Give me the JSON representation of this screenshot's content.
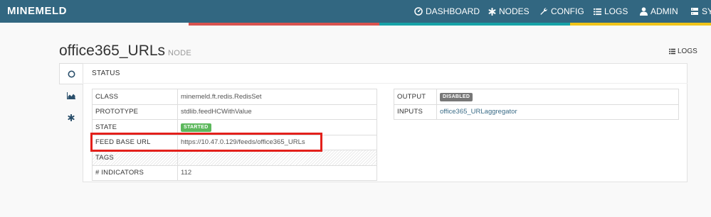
{
  "navbar": {
    "brand": "MINEMELD",
    "items": [
      {
        "label": "DASHBOARD",
        "icon": "dashboard-icon"
      },
      {
        "label": "NODES",
        "icon": "asterisk-icon"
      },
      {
        "label": "CONFIG",
        "icon": "wrench-icon"
      },
      {
        "label": "LOGS",
        "icon": "list-icon"
      },
      {
        "label": "ADMIN",
        "icon": "user-icon"
      },
      {
        "label": "SYS",
        "icon": "system-icon"
      }
    ],
    "stripe_colors": [
      "#d9534f",
      "#17a2a7",
      "#f0c419"
    ]
  },
  "page": {
    "title": "office365_URLs",
    "subtitle": "NODE",
    "logs_label": "LOGS"
  },
  "tabs": [
    {
      "icon": "circle-status-icon",
      "active": true
    },
    {
      "icon": "area-chart-icon",
      "active": false
    },
    {
      "icon": "asterisk-icon",
      "active": false
    }
  ],
  "status": {
    "section_title": "STATUS",
    "left_rows": [
      {
        "key": "CLASS",
        "value": "minemeld.ft.redis.RedisSet"
      },
      {
        "key": "PROTOTYPE",
        "value": "stdlib.feedHCWithValue"
      },
      {
        "key": "STATE",
        "value": "STARTED",
        "badge_color": "#5cb85c"
      },
      {
        "key": "FEED BASE URL",
        "value": "https://10.47.0.129/feeds/office365_URLs"
      },
      {
        "key": "TAGS",
        "value": ""
      },
      {
        "key": "# INDICATORS",
        "value": "112"
      }
    ],
    "right_rows": [
      {
        "key": "OUTPUT",
        "value": "DISABLED",
        "badge_color": "#777777"
      },
      {
        "key": "INPUTS",
        "value": "office365_URLaggregator"
      }
    ]
  },
  "highlight_color": "#e3201b"
}
